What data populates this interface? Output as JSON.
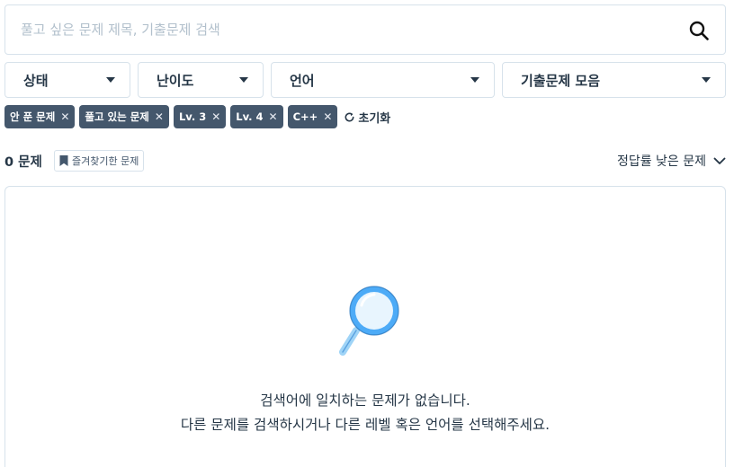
{
  "search": {
    "placeholder": "풀고 싶은 문제 제목, 기출문제 검색",
    "value": ""
  },
  "filters": [
    {
      "label": "상태"
    },
    {
      "label": "난이도"
    },
    {
      "label": "언어"
    },
    {
      "label": "기출문제 모음"
    }
  ],
  "active_filters": [
    {
      "label": "안 푼 문제"
    },
    {
      "label": "풀고 있는 문제"
    },
    {
      "label": "Lv. 3"
    },
    {
      "label": "Lv. 4"
    },
    {
      "label": "C++"
    }
  ],
  "reset_label": "초기화",
  "result": {
    "count_label": "0 문제",
    "bookmark_label": "즐겨찾기한 문제",
    "sort_label": "정답률 낮은 문제"
  },
  "empty_state": {
    "line1": "검색어에 일치하는 문제가 없습니다.",
    "line2": "다른 문제를 검색하시거나 다른 레벨 혹은 언어를 선택해주세요."
  },
  "colors": {
    "chip_bg": "#44576c",
    "border": "#d7e2eb",
    "text": "#263747",
    "accent": "#4dabf7"
  }
}
